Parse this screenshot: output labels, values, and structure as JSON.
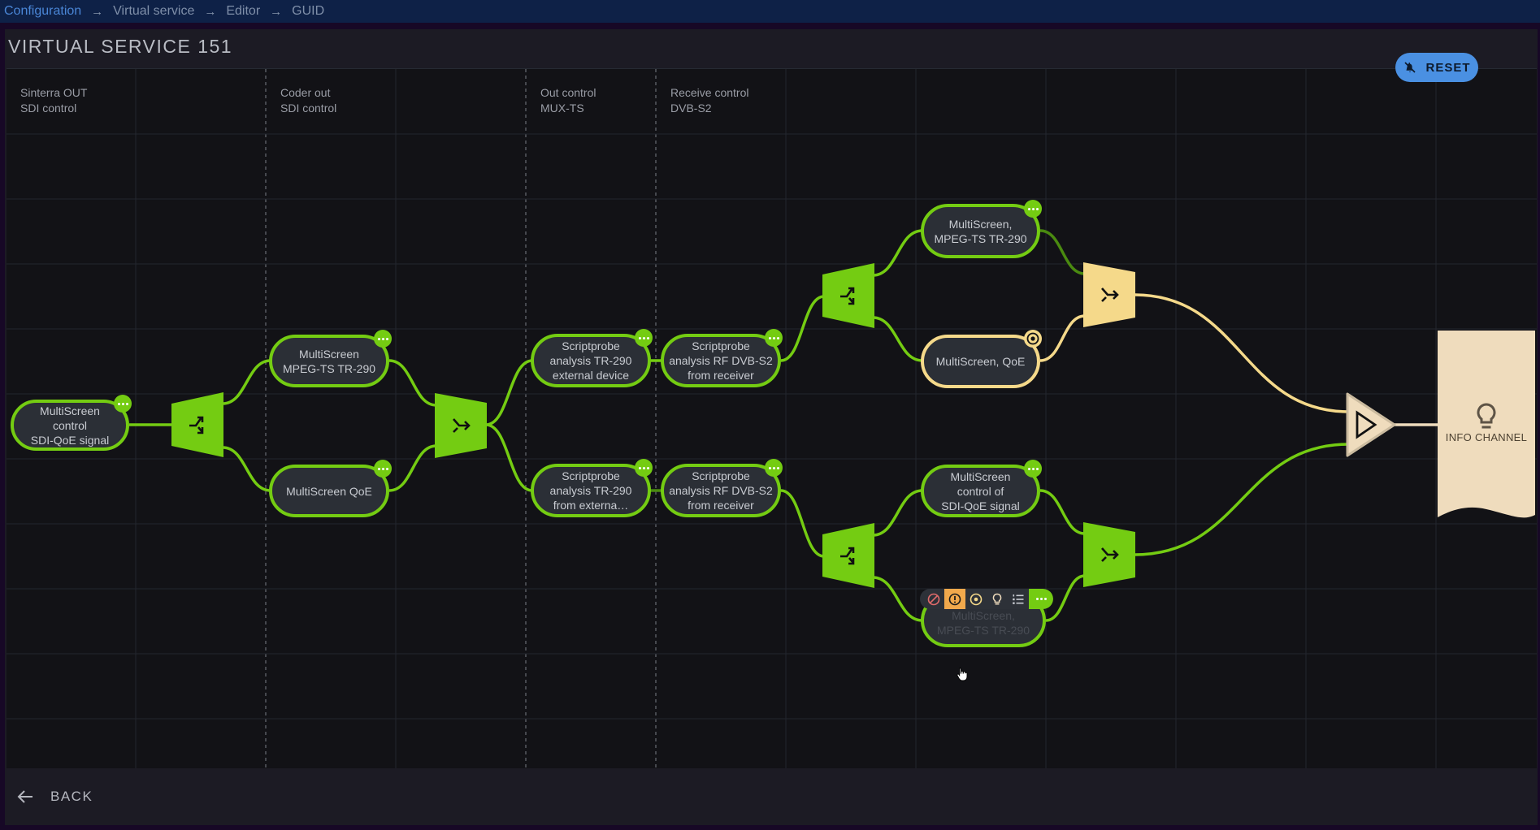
{
  "breadcrumb": {
    "items": [
      {
        "label": "Configuration",
        "link": true
      },
      {
        "label": "Virtual service",
        "link": false
      },
      {
        "label": "Editor",
        "link": false
      },
      {
        "label": "GUID",
        "link": false
      }
    ],
    "separator": "→"
  },
  "page": {
    "title": "VIRTUAL SERVICE 151",
    "reset_label": "RESET",
    "back_label": "BACK"
  },
  "colors": {
    "active_green": "#74cc12",
    "warning_yellow": "#f5d98a",
    "info_beige": "#efdcbd",
    "accent_blue": "#4a90e2",
    "toolbar_active": "#f1a94c"
  },
  "columns": [
    {
      "line1": "Sinterra OUT",
      "line2": "SDI control"
    },
    {
      "line1": "Coder out",
      "line2": "SDI control"
    },
    {
      "line1": "Out control",
      "line2": "MUX-TS"
    },
    {
      "line1": "Receive control",
      "line2": "DVB-S2"
    }
  ],
  "nodes": [
    {
      "id": "n1",
      "label": "MultiScreen\ncontrol\nSDI-QoE signal",
      "status": "ok",
      "badge": "more"
    },
    {
      "id": "n2",
      "label": "MultiScreen\nMPEG-TS TR-290",
      "status": "ok",
      "badge": "more"
    },
    {
      "id": "n3",
      "label": "MultiScreen QoE",
      "status": "ok",
      "badge": "more"
    },
    {
      "id": "n4",
      "label": "Scriptprobe\nanalysis TR-290\nexternal  device",
      "status": "ok",
      "badge": "more"
    },
    {
      "id": "n5",
      "label": "Scriptprobe\nanalysis RF DVB-S2\nfrom receiver",
      "status": "ok",
      "badge": "more"
    },
    {
      "id": "n6",
      "label": "Scriptprobe\nanalysis TR-290\nfrom externa…",
      "status": "ok",
      "badge": "more"
    },
    {
      "id": "n7",
      "label": "Scriptprobe\nanalysis RF DVB-S2\nfrom receiver",
      "status": "ok",
      "badge": "more"
    },
    {
      "id": "n8",
      "label": "MultiScreen,\nMPEG-TS TR-290",
      "status": "ok",
      "badge": "more"
    },
    {
      "id": "n9",
      "label": "MultiScreen, QoE",
      "status": "warning",
      "badge": "target"
    },
    {
      "id": "n10",
      "label": "MultiScreen\ncontrol of\nSDI-QoE signal",
      "status": "ok",
      "badge": "more"
    },
    {
      "id": "n11",
      "label": "MultiScreen,\nMPEG-TS TR-290",
      "status": "ok",
      "badge": "toolbar"
    }
  ],
  "gates": [
    {
      "id": "g1",
      "type": "split",
      "status": "ok"
    },
    {
      "id": "g2",
      "type": "merge",
      "status": "ok"
    },
    {
      "id": "g3",
      "type": "split",
      "status": "ok"
    },
    {
      "id": "g4",
      "type": "merge",
      "status": "warning"
    },
    {
      "id": "g5",
      "type": "split",
      "status": "ok"
    },
    {
      "id": "g6",
      "type": "merge",
      "status": "ok"
    },
    {
      "id": "out",
      "type": "output",
      "status": "info"
    }
  ],
  "info_channel": {
    "label": "INFO CHANNEL",
    "icon": "lightbulb-icon"
  },
  "node_toolbar": {
    "items": [
      {
        "name": "disable",
        "icon": "block-icon",
        "active": false
      },
      {
        "name": "warning",
        "icon": "alert-icon",
        "active": true
      },
      {
        "name": "target",
        "icon": "target-icon",
        "active": false
      },
      {
        "name": "info",
        "icon": "lightbulb-icon",
        "active": false
      },
      {
        "name": "list",
        "icon": "numbered-list-icon",
        "active": false
      },
      {
        "name": "more",
        "icon": "more-icon",
        "active": false
      }
    ]
  }
}
